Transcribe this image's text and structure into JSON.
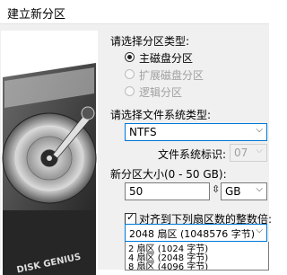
{
  "window": {
    "title": "建立新分区"
  },
  "partition_type": {
    "label": "请选择分区类型:",
    "options": [
      {
        "label": "主磁盘分区",
        "checked": true,
        "enabled": true
      },
      {
        "label": "扩展磁盘分区",
        "checked": false,
        "enabled": false
      },
      {
        "label": "逻辑分区",
        "checked": false,
        "enabled": false
      }
    ]
  },
  "filesystem": {
    "label": "请选择文件系统类型:",
    "selected": "NTFS"
  },
  "fs_id": {
    "label": "文件系统标识:",
    "value": "07"
  },
  "size": {
    "label": "新分区大小(0 - 50 GB):",
    "value": "50",
    "unit": "GB"
  },
  "align": {
    "label": "对齐到下列扇区数的整数倍:",
    "checked": true
  },
  "sector": {
    "selected": "2048 扇区 (1048576 字节)",
    "options": [
      "2 扇区 (1024 字节)",
      "4 扇区 (2048 字节)",
      "8 扇区 (4096 字节)"
    ]
  },
  "graphic": {
    "logo_text": "DISK GENIUS"
  },
  "colors": {
    "focus_blue": "#0078d7",
    "disabled_gray": "#a0a0a0"
  }
}
